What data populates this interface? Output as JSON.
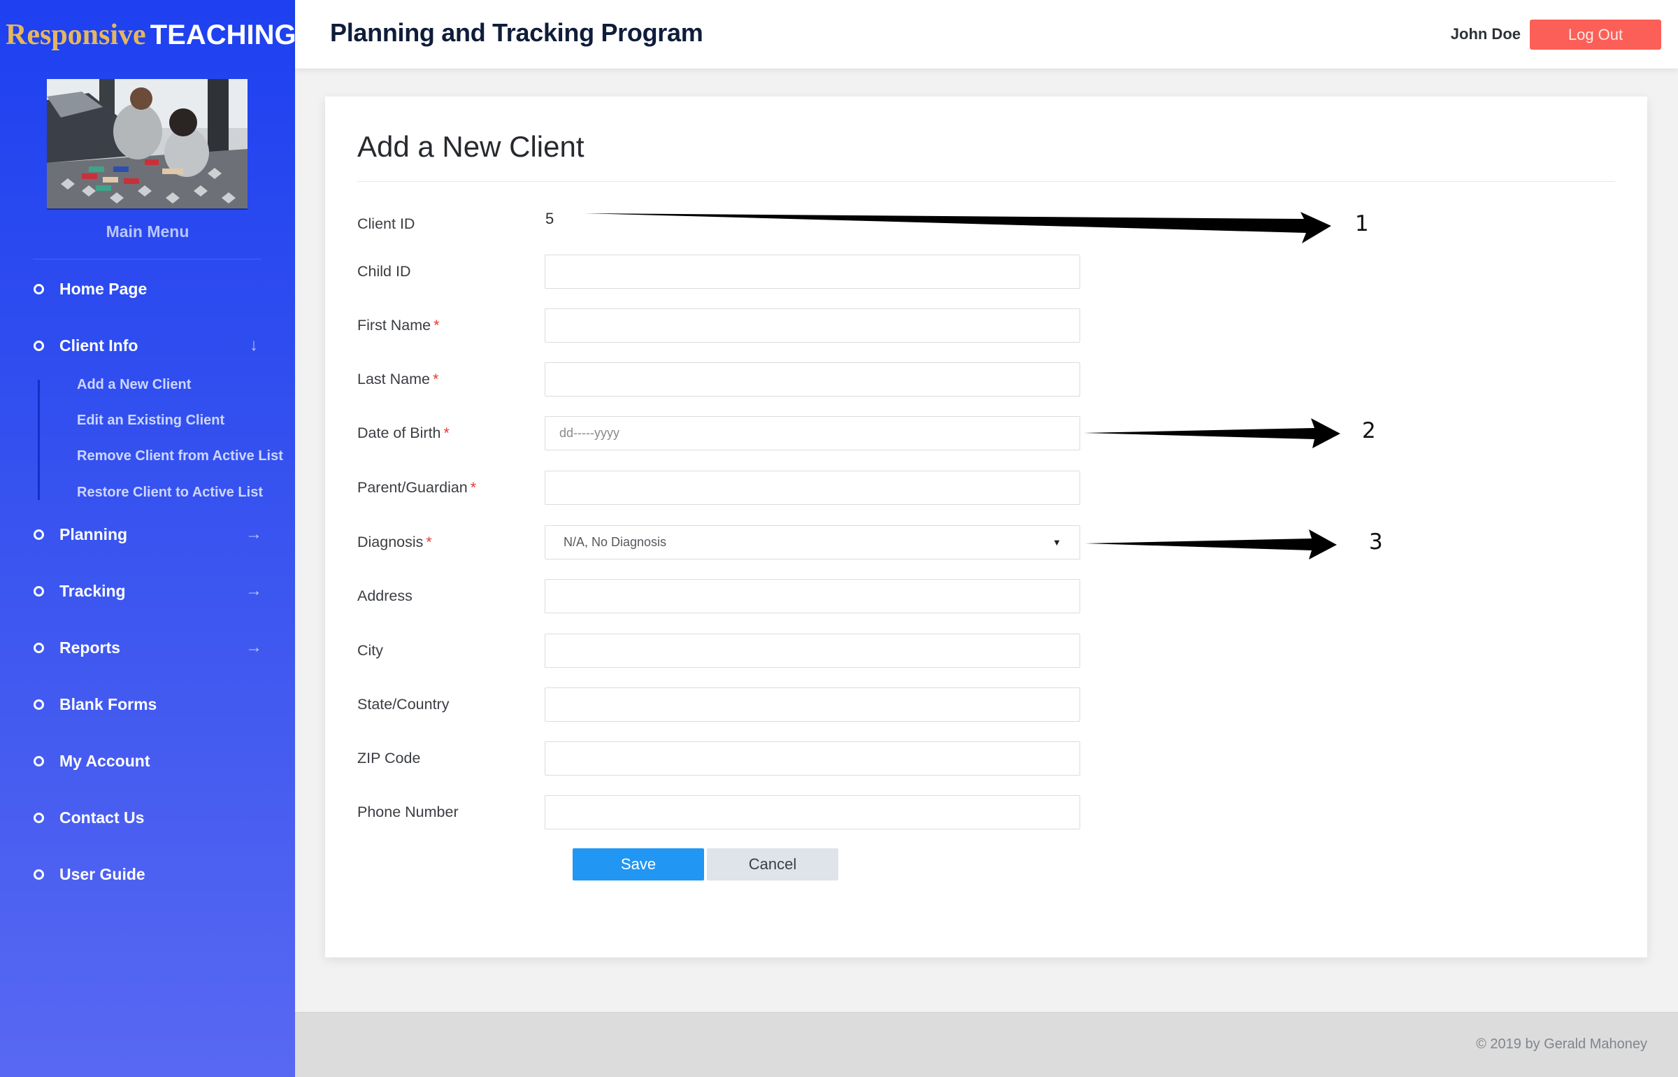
{
  "brand": {
    "part1": "Responsive",
    "part2": "TEACHING",
    "part1_color": "#e5b75c",
    "part2_color": "#ffffff"
  },
  "sidebar": {
    "photo_alt": "Adult and child playing with wooden blocks on a rug",
    "menu_heading": "Main Menu",
    "items": [
      {
        "label": "Home Page",
        "arrow": ""
      },
      {
        "label": "Client Info",
        "arrow": "↓"
      },
      {
        "label": "Planning",
        "arrow": "→"
      },
      {
        "label": "Tracking",
        "arrow": "→"
      },
      {
        "label": "Reports",
        "arrow": "→"
      },
      {
        "label": "Blank Forms",
        "arrow": ""
      },
      {
        "label": "My Account",
        "arrow": ""
      },
      {
        "label": "Contact Us",
        "arrow": ""
      },
      {
        "label": "User Guide",
        "arrow": ""
      }
    ],
    "client_info_sub": [
      {
        "label": "Add a New Client"
      },
      {
        "label": "Edit an Existing Client"
      },
      {
        "label": "Remove Client from Active List"
      },
      {
        "label": "Restore Client to Active List"
      }
    ],
    "gradient_colors": [
      "#1e40f0",
      "#5868f2"
    ]
  },
  "header": {
    "title": "Planning and Tracking Program",
    "user_name": "John Doe",
    "logout_label": "Log Out",
    "logout_color": "#fc5f57"
  },
  "form": {
    "title": "Add a New Client",
    "required_marker": "*",
    "client_id": {
      "label": "Client ID",
      "value": "5"
    },
    "child_id": {
      "label": "Child ID",
      "value": ""
    },
    "first_name": {
      "label": "First Name",
      "value": ""
    },
    "last_name": {
      "label": "Last Name",
      "value": ""
    },
    "dob": {
      "label": "Date of Birth",
      "placeholder": "dd-----yyyy"
    },
    "parent": {
      "label": "Parent/Guardian",
      "value": ""
    },
    "diagnosis": {
      "label": "Diagnosis",
      "selected": "N/A, No Diagnosis",
      "caret": "▼"
    },
    "address": {
      "label": "Address",
      "value": ""
    },
    "city": {
      "label": "City",
      "value": ""
    },
    "state": {
      "label": "State/Country",
      "value": ""
    },
    "zip": {
      "label": "ZIP Code",
      "value": ""
    },
    "phone": {
      "label": "Phone Number",
      "value": ""
    },
    "save_label": "Save",
    "cancel_label": "Cancel",
    "save_color": "#2196f3"
  },
  "annotations": {
    "n1": "1",
    "n2": "2",
    "n3": "3"
  },
  "footer": {
    "copyright": "© 2019 by Gerald Mahoney"
  }
}
